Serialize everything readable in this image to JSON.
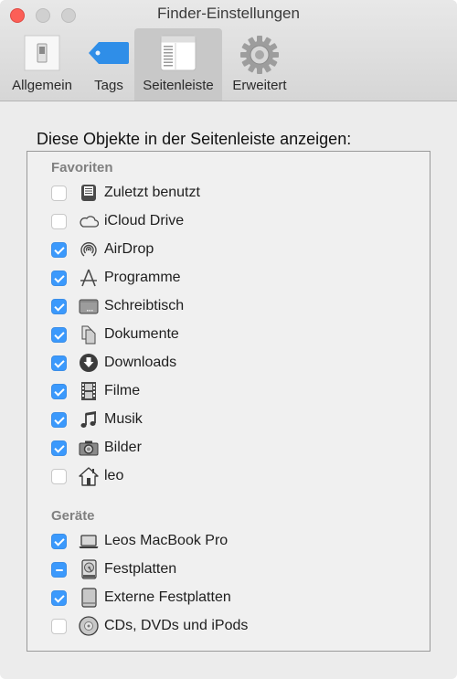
{
  "window": {
    "title": "Finder-Einstellungen",
    "controls": [
      "close",
      "minimize",
      "zoom"
    ]
  },
  "toolbar": {
    "tabs": [
      {
        "label": "Allgemein",
        "icon": "switch-icon",
        "selected": false
      },
      {
        "label": "Tags",
        "icon": "tag-icon",
        "selected": false
      },
      {
        "label": "Seitenleiste",
        "icon": "sidebar-icon",
        "selected": true
      },
      {
        "label": "Erweitert",
        "icon": "gear-icon",
        "selected": false
      }
    ]
  },
  "main": {
    "heading": "Diese Objekte in der Seitenleiste anzeigen:",
    "sections": [
      {
        "title": "Favoriten",
        "items": [
          {
            "label": "Zuletzt benutzt",
            "icon": "recents-icon",
            "state": "unchecked"
          },
          {
            "label": "iCloud Drive",
            "icon": "cloud-icon",
            "state": "unchecked"
          },
          {
            "label": "AirDrop",
            "icon": "airdrop-icon",
            "state": "checked"
          },
          {
            "label": "Programme",
            "icon": "applications-icon",
            "state": "checked"
          },
          {
            "label": "Schreibtisch",
            "icon": "desktop-icon",
            "state": "checked"
          },
          {
            "label": "Dokumente",
            "icon": "documents-icon",
            "state": "checked"
          },
          {
            "label": "Downloads",
            "icon": "downloads-icon",
            "state": "checked"
          },
          {
            "label": "Filme",
            "icon": "film-icon",
            "state": "checked"
          },
          {
            "label": "Musik",
            "icon": "music-note-icon",
            "state": "checked"
          },
          {
            "label": "Bilder",
            "icon": "camera-icon",
            "state": "checked"
          },
          {
            "label": "leo",
            "icon": "home-icon",
            "state": "unchecked"
          }
        ]
      },
      {
        "title": "Geräte",
        "items": [
          {
            "label": "Leos MacBook Pro",
            "icon": "laptop-icon",
            "state": "checked"
          },
          {
            "label": "Festplatten",
            "icon": "hard-disk-icon",
            "state": "mixed"
          },
          {
            "label": "Externe Festplatten",
            "icon": "external-disk-icon",
            "state": "checked"
          },
          {
            "label": "CDs, DVDs und iPods",
            "icon": "optical-disc-icon",
            "state": "unchecked"
          }
        ]
      }
    ]
  },
  "colors": {
    "accent": "#3b99fc",
    "close": "#fc5f57",
    "section_title": "#808080"
  }
}
